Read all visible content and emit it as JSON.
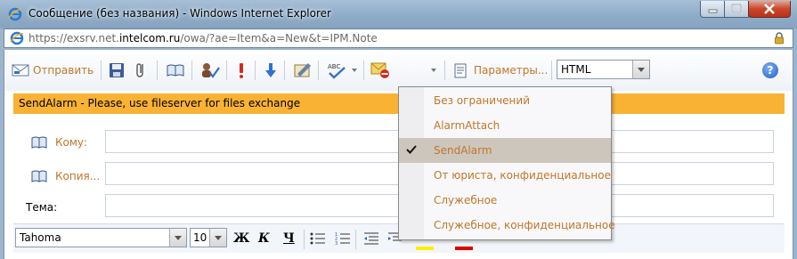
{
  "window": {
    "title": "Сообщение (без названия) - Windows Internet Explorer",
    "url_prefix": "https://exsrv.net.",
    "url_host": "intelcom.ru",
    "url_path": "/owa/?ae=Item&a=New&t=IPM.Note"
  },
  "toolbar": {
    "send_label": "Отправить",
    "options_label": "Параметры...",
    "format_value": "HTML",
    "help_label": "?"
  },
  "banner": {
    "text": "SendAlarm - Please, use fileserver for files exchange"
  },
  "fields": {
    "to_label": "Кому:",
    "cc_label": "Копия...",
    "subject_label": "Тема:"
  },
  "format": {
    "font_value": "Tahoma",
    "size_value": "10",
    "bold_glyph": "Ж",
    "italic_glyph": "К",
    "underline_glyph": "Ч",
    "highlight_color": "#ffee00",
    "font_color": "#e00000"
  },
  "menu": {
    "items": [
      {
        "label": "Без ограничений",
        "checked": false
      },
      {
        "label": "AlarmAttach",
        "checked": false
      },
      {
        "label": "SendAlarm",
        "checked": true
      },
      {
        "label": "От юриста, конфиденциальное",
        "checked": false
      },
      {
        "label": "Служебное",
        "checked": false
      },
      {
        "label": "Служебное, конфиденциальное",
        "checked": false
      }
    ]
  },
  "colors": {
    "link_orange": "#c0762a",
    "banner": "#f9b233",
    "menu_selected": "#cdc6bd"
  }
}
